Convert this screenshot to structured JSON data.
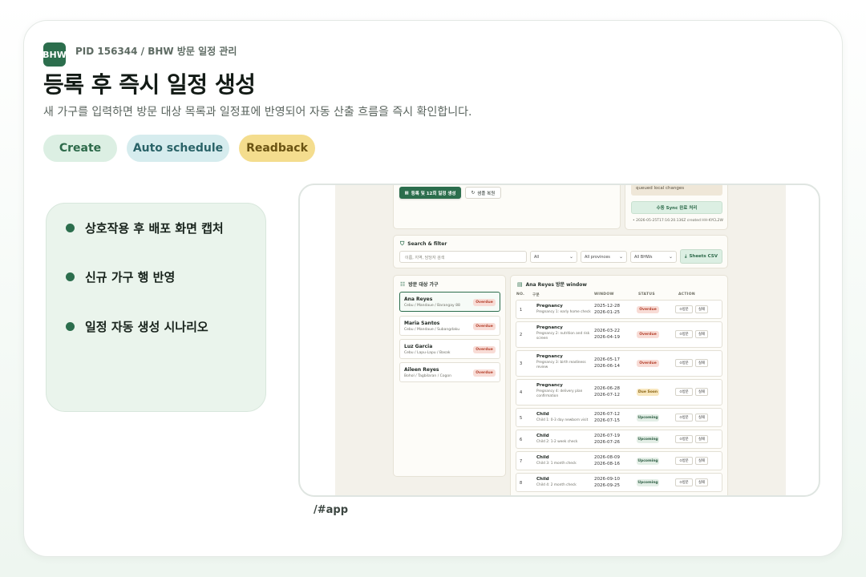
{
  "header": {
    "logo_text": "BHW",
    "pid": "PID 156344 / BHW 방문 일정 관리",
    "title": "등록 후 즉시 일정 생성",
    "subtitle": "새 가구를 입력하면 방문 대상 목록과 일정표에 반영되어 자동 산출 흐름을 즉시 확인합니다."
  },
  "tags": [
    "Create",
    "Auto schedule",
    "Readback"
  ],
  "notes": [
    "상호작용 후 배포 화면 캡처",
    "신규 가구 행 반영",
    "일정 자동 생성 시나리오"
  ],
  "url": "/#app",
  "app": {
    "register_button": "등록 및 12회 일정 생성",
    "restore_button": "샘플 복원",
    "queued_text": "queued local changes",
    "sync_button": "수동 Sync 완료 처리",
    "log_line": "2026-05-25T17:16:20.136Z created HH-KYCL2W",
    "search": {
      "title": "Search & filter",
      "placeholder": "이름, 지역, 담당자 검색",
      "filter_all": "All",
      "filter_provinces": "All provinces",
      "filter_bhws": "All BHWs",
      "csv_button": "Sheets CSV"
    },
    "households_title": "방문 대상 가구",
    "households": [
      {
        "name": "Ana Reyes",
        "location": "Cebu / Mandaue / Barangay 88",
        "status": "Overdue"
      },
      {
        "name": "Maria Santos",
        "location": "Cebu / Mandaue / Subangdaku",
        "status": "Overdue"
      },
      {
        "name": "Luz Garcia",
        "location": "Cebu / Lapu-Lapu / Basak",
        "status": "Overdue"
      },
      {
        "name": "Aileen Reyes",
        "location": "Bohol / Tagbilaran / Cogon",
        "status": "Overdue"
      }
    ],
    "window_title": "Ana Reyes 방문 window",
    "columns": {
      "no": "NO.",
      "type": "구분",
      "window": "WINDOW",
      "status": "STATUS",
      "action": "ACTION"
    },
    "visit_button": "방문",
    "fail_button": "실패",
    "visits": [
      {
        "no": "1",
        "category": "Pregnancy",
        "desc": "Pregnancy 1: early home check",
        "start": "2025-12-28",
        "end": "2026-01-25",
        "status": "Overdue"
      },
      {
        "no": "2",
        "category": "Pregnancy",
        "desc": "Pregnancy 2: nutrition and risk screen",
        "start": "2026-03-22",
        "end": "2026-04-19",
        "status": "Overdue"
      },
      {
        "no": "3",
        "category": "Pregnancy",
        "desc": "Pregnancy 3: birth readiness review",
        "start": "2026-05-17",
        "end": "2026-06-14",
        "status": "Overdue"
      },
      {
        "no": "4",
        "category": "Pregnancy",
        "desc": "Pregnancy 4: delivery plan confirmation",
        "start": "2026-06-28",
        "end": "2026-07-12",
        "status": "Due Soon"
      },
      {
        "no": "5",
        "category": "Child",
        "desc": "Child 1: 0-3 day newborn visit",
        "start": "2026-07-12",
        "end": "2026-07-15",
        "status": "Upcoming"
      },
      {
        "no": "6",
        "category": "Child",
        "desc": "Child 2: 1-2 week check",
        "start": "2026-07-19",
        "end": "2026-07-26",
        "status": "Upcoming"
      },
      {
        "no": "7",
        "category": "Child",
        "desc": "Child 3: 1 month check",
        "start": "2026-08-09",
        "end": "2026-08-16",
        "status": "Upcoming"
      },
      {
        "no": "8",
        "category": "Child",
        "desc": "Child 4: 2 month check",
        "start": "2026-09-10",
        "end": "2026-09-25",
        "status": "Upcoming"
      }
    ]
  }
}
